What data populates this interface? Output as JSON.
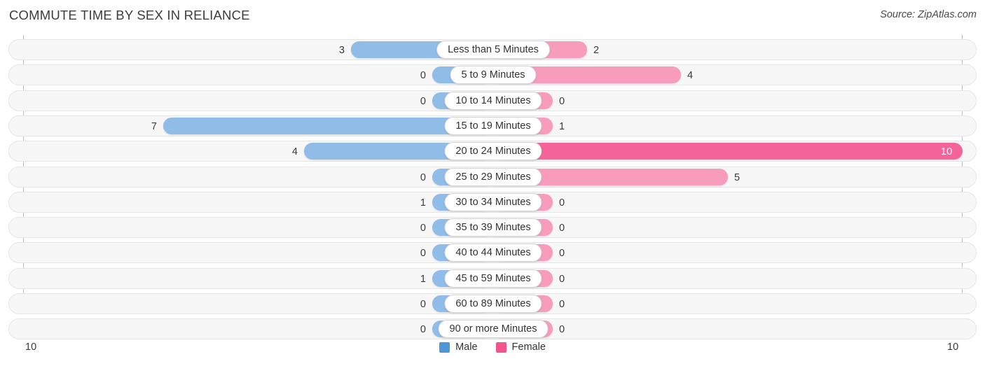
{
  "header": {
    "title": "COMMUTE TIME BY SEX IN RELIANCE",
    "source": "Source: ZipAtlas.com"
  },
  "legend": {
    "items": [
      {
        "label": "Male",
        "color": "#4e95d9"
      },
      {
        "label": "Female",
        "color": "#f2558c"
      }
    ]
  },
  "axis": {
    "left_end_label": "10",
    "right_end_label": "10"
  },
  "chart_data": {
    "type": "bar",
    "subtype": "diverging-bar",
    "title": "COMMUTE TIME BY SEX IN RELIANCE",
    "source": "Source: ZipAtlas.com",
    "xlabel": "",
    "ylabel": "",
    "xlim": [
      10,
      10
    ],
    "axis_max": 10,
    "grid": false,
    "legend_position": "bottom-center",
    "categories": [
      "Less than 5 Minutes",
      "5 to 9 Minutes",
      "10 to 14 Minutes",
      "15 to 19 Minutes",
      "20 to 24 Minutes",
      "25 to 29 Minutes",
      "30 to 34 Minutes",
      "35 to 39 Minutes",
      "40 to 44 Minutes",
      "45 to 59 Minutes",
      "60 to 89 Minutes",
      "90 or more Minutes"
    ],
    "series": [
      {
        "name": "Male",
        "direction": "left",
        "color": "#90bce8",
        "highlight_color": "#5b9bd8",
        "values": [
          3,
          0,
          0,
          7,
          4,
          0,
          1,
          0,
          0,
          1,
          0,
          0
        ],
        "labels": [
          "3",
          "0",
          "0",
          "7",
          "4",
          "0",
          "1",
          "0",
          "0",
          "1",
          "0",
          "0"
        ]
      },
      {
        "name": "Female",
        "direction": "right",
        "color": "#f79cba",
        "highlight_color": "#f4649a",
        "values": [
          2,
          4,
          0,
          1,
          10,
          5,
          0,
          0,
          0,
          0,
          0,
          0
        ],
        "labels": [
          "2",
          "4",
          "0",
          "1",
          "10",
          "5",
          "0",
          "0",
          "0",
          "0",
          "0",
          "0"
        ]
      }
    ]
  }
}
